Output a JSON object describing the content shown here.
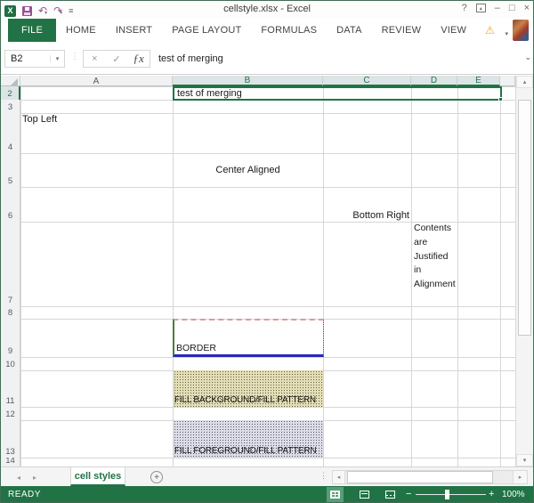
{
  "titlebar": {
    "title": "cellstyle.xlsx - Excel"
  },
  "icons": {
    "app": "X",
    "undo": "↶",
    "redo": "↷",
    "caret_down": "▾",
    "qat_more": "≡",
    "help": "?",
    "ribbon_display_arrow": "▴",
    "minimize": "–",
    "maximize": "□",
    "close": "×",
    "warning": "⚠",
    "namebox_caret": "▾",
    "separator_dots": "⋮",
    "cancel": "×",
    "enter": "✓",
    "fx": "ƒx",
    "formula_chevron": "⌄",
    "nav_left": "◂",
    "nav_right": "▸",
    "add_sheet": "+",
    "sheet_dots": "⋮",
    "scroll_up": "▴",
    "scroll_down": "▾",
    "scroll_left": "◂",
    "scroll_right": "▸",
    "zoom_minus": "−",
    "zoom_plus": "+"
  },
  "ribbon": {
    "tabs": [
      "FILE",
      "HOME",
      "INSERT",
      "PAGE LAYOUT",
      "FORMULAS",
      "DATA",
      "REVIEW",
      "VIEW"
    ],
    "active_tab": "FILE"
  },
  "formula_bar": {
    "cell_reference": "B2",
    "formula": "test of merging"
  },
  "grid": {
    "column_letters": [
      "A",
      "B",
      "C",
      "D",
      "E"
    ],
    "selected_columns": [
      "B",
      "C",
      "D",
      "E"
    ],
    "selected_cell": "B2",
    "row_numbers": [
      "2",
      "3",
      "4",
      "5",
      "6",
      "7",
      "8",
      "9",
      "10",
      "11",
      "12",
      "13",
      "14"
    ],
    "cells": {
      "b2": "test of merging",
      "a4": "Top Left",
      "b5": "Center Aligned",
      "c6": "Bottom Right",
      "d7": "Contents are Justified in Alignment",
      "b9": "BORDER",
      "b11": "FILL BACKGROUND/FILL PATTERN",
      "b13": "FILL FOREGROUND/FILL PATTERN"
    }
  },
  "sheet_bar": {
    "active_tab": "cell styles"
  },
  "status_bar": {
    "mode": "READY",
    "zoom_level": "100%"
  },
  "colors": {
    "excel_green": "#217346",
    "selection_border": "#217346",
    "b9_border_top": "#dc9a9a",
    "b9_border_left": "#4a7d3c",
    "b9_border_bottom": "#2828bc",
    "fill_background_pattern": "#e3ddb6",
    "fill_foreground_pattern": "#dcdce6",
    "qat_icon_purple": "#9b4f96",
    "warning_orange": "#efa51d"
  }
}
